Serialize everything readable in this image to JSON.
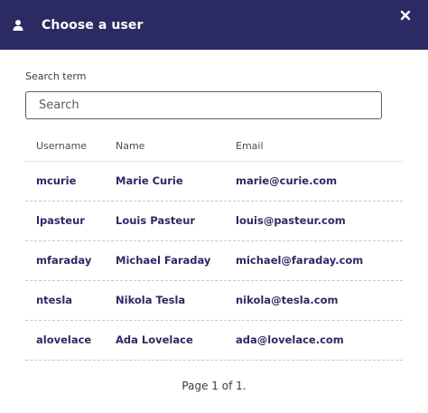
{
  "header": {
    "title": "Choose a user",
    "icon": "user-icon",
    "close_icon": "close-icon",
    "background": "#2c2a63"
  },
  "search": {
    "label": "Search term",
    "placeholder": "Search",
    "value": ""
  },
  "table": {
    "columns": [
      "Username",
      "Name",
      "Email"
    ],
    "rows": [
      {
        "username": "mcurie",
        "name": "Marie Curie",
        "email": "marie@curie.com"
      },
      {
        "username": "lpasteur",
        "name": "Louis Pasteur",
        "email": "louis@pasteur.com"
      },
      {
        "username": "mfaraday",
        "name": "Michael Faraday",
        "email": "michael@faraday.com"
      },
      {
        "username": "ntesla",
        "name": "Nikola Tesla",
        "email": "nikola@tesla.com"
      },
      {
        "username": "alovelace",
        "name": "Ada Lovelace",
        "email": "ada@lovelace.com"
      }
    ]
  },
  "pager": {
    "text": "Page 1 of 1."
  }
}
